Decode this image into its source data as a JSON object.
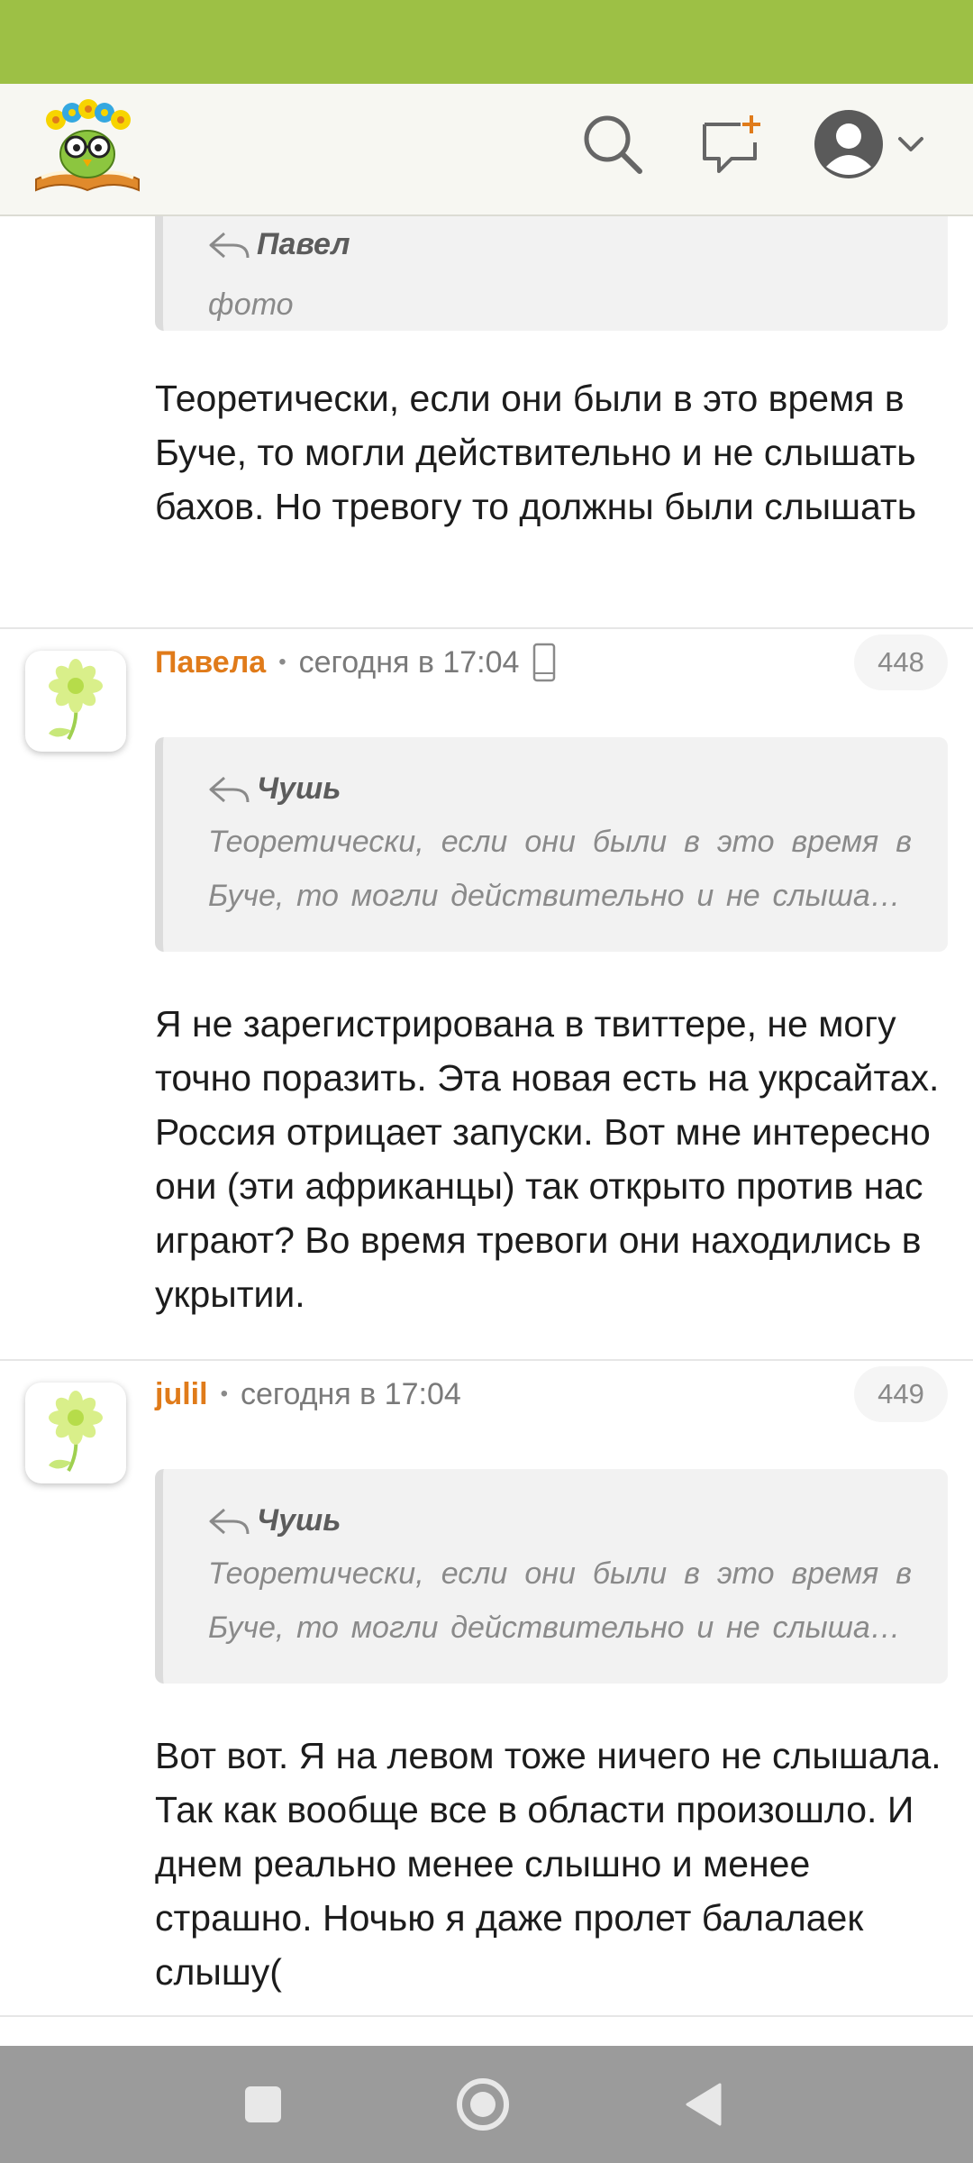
{
  "header": {
    "logo_icon": "owl-on-book-logo",
    "search_icon": "search-icon",
    "new_message_icon": "new-message-icon",
    "profile_icon": "user-avatar-icon"
  },
  "feed": {
    "first_post": {
      "quote_author": "Павел",
      "quote_text": "фото",
      "text": "Теоретически, если они были в это время в Буче, то могли действительно и не слышать бахов. Но тревогу то должны были слышать"
    },
    "comments": [
      {
        "author": "Павела",
        "time": "сегодня в 17:04",
        "device_icon": "mobile-phone-icon",
        "number": "448",
        "quote_author": "Чушь",
        "quote_text": "Теоретически, если они были в это время в Буче, то могли действительно и не слышать бахов. Но тревогу то должны были слышать",
        "text": "Я не зарегистрирована в твиттере, не могу точно поразить. Эта новая есть на укрсайтах. Россия отрицает запуски. Вот мне интересно они (эти африканцы) так открыто против нас играют? Во время тревоги они находились в укрытии."
      },
      {
        "author": "julil",
        "time": "сегодня в 17:04",
        "number": "449",
        "quote_author": "Чушь",
        "quote_text": "Теоретически, если они были в это время в Буче, то могли действительно и не слышать бахов. Но тревогу то должны были слышать",
        "text": "Вот вот. Я на левом тоже ничего не слышала. Так как вообще все в области произошло. И днем реально менее слышно и менее страшно. Ночью я даже пролет балалаек слышу("
      }
    ]
  },
  "colors": {
    "status_bar": "#9dc045",
    "author": "#e07b1a",
    "nav_bar": "#9b9b9b"
  }
}
